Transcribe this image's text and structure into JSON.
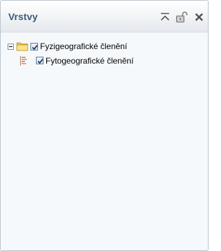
{
  "panel": {
    "title": "Vrstvy",
    "buttons": {
      "collapse": "collapse-up-icon",
      "lock": "unlock-icon",
      "close": "close-icon"
    }
  },
  "tree": [
    {
      "label": "Fyzigeografické členění",
      "expanded": true,
      "checked": true,
      "icon": "folder-icon",
      "children": [
        {
          "label": "Fytogeografické členění",
          "checked": true,
          "icon": "layer-legend-icon"
        }
      ]
    }
  ],
  "colors": {
    "title": "#3d5a78",
    "background": "#f6f9fc",
    "folder": "#f3c849"
  }
}
